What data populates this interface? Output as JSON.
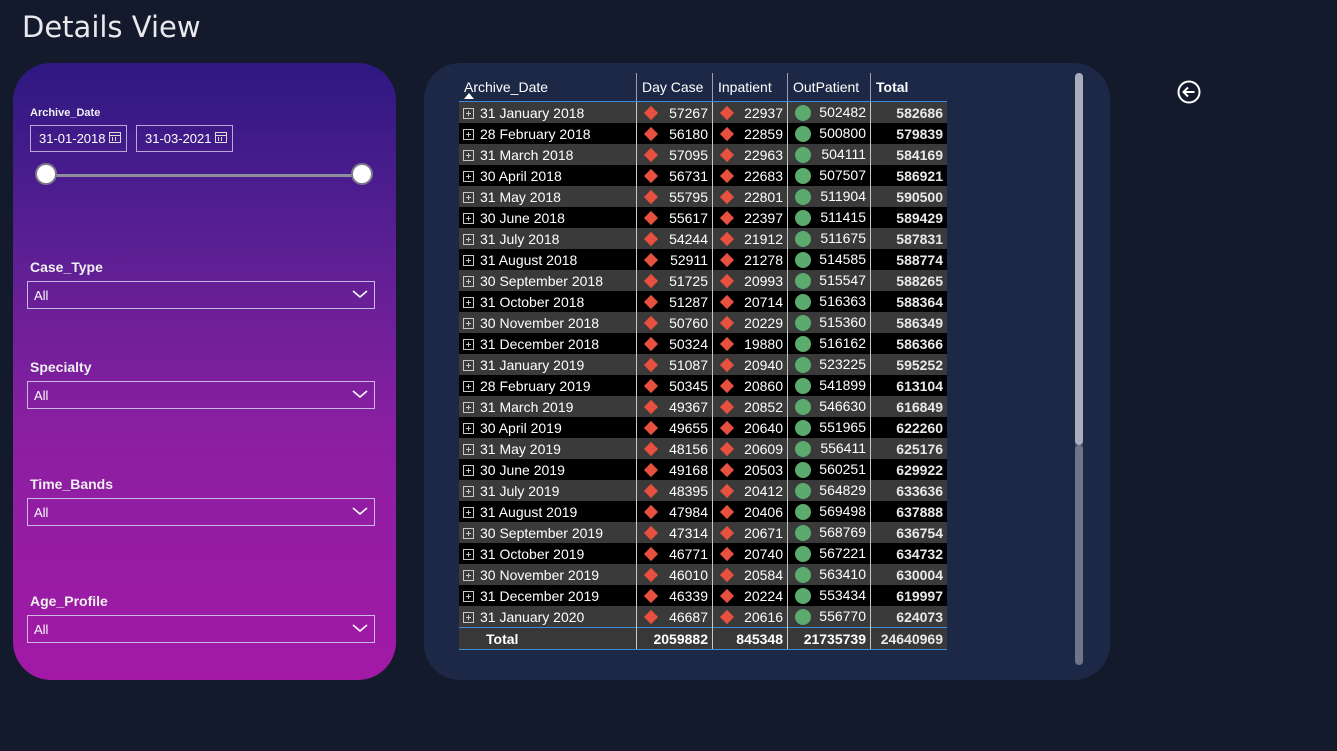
{
  "page": {
    "title": "Details View"
  },
  "filters": {
    "archive_date": {
      "label": "Archive_Date",
      "start": "31-01-2018",
      "end": "31-03-2021",
      "range_start_fraction": 0.0,
      "range_end_fraction": 1.0
    },
    "case_type": {
      "label": "Case_Type",
      "value": "All"
    },
    "specialty": {
      "label": "Specialty",
      "value": "All"
    },
    "time_bands": {
      "label": "Time_Bands",
      "value": "All"
    },
    "age_profile": {
      "label": "Age_Profile",
      "value": "All"
    }
  },
  "table": {
    "columns": [
      "Archive_Date",
      "Day Case",
      "Inpatient",
      "OutPatient",
      "Total"
    ],
    "rows": [
      [
        "31 January 2018",
        "57267",
        "22937",
        "502482",
        "582686"
      ],
      [
        "28 February 2018",
        "56180",
        "22859",
        "500800",
        "579839"
      ],
      [
        "31 March 2018",
        "57095",
        "22963",
        "504111",
        "584169"
      ],
      [
        "30 April 2018",
        "56731",
        "22683",
        "507507",
        "586921"
      ],
      [
        "31 May 2018",
        "55795",
        "22801",
        "511904",
        "590500"
      ],
      [
        "30 June 2018",
        "55617",
        "22397",
        "511415",
        "589429"
      ],
      [
        "31 July 2018",
        "54244",
        "21912",
        "511675",
        "587831"
      ],
      [
        "31 August 2018",
        "52911",
        "21278",
        "514585",
        "588774"
      ],
      [
        "30 September 2018",
        "51725",
        "20993",
        "515547",
        "588265"
      ],
      [
        "31 October 2018",
        "51287",
        "20714",
        "516363",
        "588364"
      ],
      [
        "30 November 2018",
        "50760",
        "20229",
        "515360",
        "586349"
      ],
      [
        "31 December 2018",
        "50324",
        "19880",
        "516162",
        "586366"
      ],
      [
        "31 January 2019",
        "51087",
        "20940",
        "523225",
        "595252"
      ],
      [
        "28 February 2019",
        "50345",
        "20860",
        "541899",
        "613104"
      ],
      [
        "31 March 2019",
        "49367",
        "20852",
        "546630",
        "616849"
      ],
      [
        "30 April 2019",
        "49655",
        "20640",
        "551965",
        "622260"
      ],
      [
        "31 May 2019",
        "48156",
        "20609",
        "556411",
        "625176"
      ],
      [
        "30 June 2019",
        "49168",
        "20503",
        "560251",
        "629922"
      ],
      [
        "31 July 2019",
        "48395",
        "20412",
        "564829",
        "633636"
      ],
      [
        "31 August 2019",
        "47984",
        "20406",
        "569498",
        "637888"
      ],
      [
        "30 September 2019",
        "47314",
        "20671",
        "568769",
        "636754"
      ],
      [
        "31 October 2019",
        "46771",
        "20740",
        "567221",
        "634732"
      ],
      [
        "30 November 2019",
        "46010",
        "20584",
        "563410",
        "630004"
      ],
      [
        "31 December 2019",
        "46339",
        "20224",
        "553434",
        "619997"
      ],
      [
        "31 January 2020",
        "46687",
        "20616",
        "556770",
        "624073"
      ]
    ],
    "totals": {
      "label": "Total",
      "day_case": "2059882",
      "inpatient": "845348",
      "outpatient": "21735739",
      "total": "24640969"
    },
    "indicator_colors": {
      "day_case": "#e8503f",
      "inpatient": "#e8503f",
      "outpatient": "#5aab6d"
    },
    "indicator_icons": {
      "day_case": "red-diamond-icon",
      "inpatient": "red-diamond-icon",
      "outpatient": "green-circle-icon"
    }
  },
  "nav": {
    "back_icon": "back-arrow-icon"
  }
}
